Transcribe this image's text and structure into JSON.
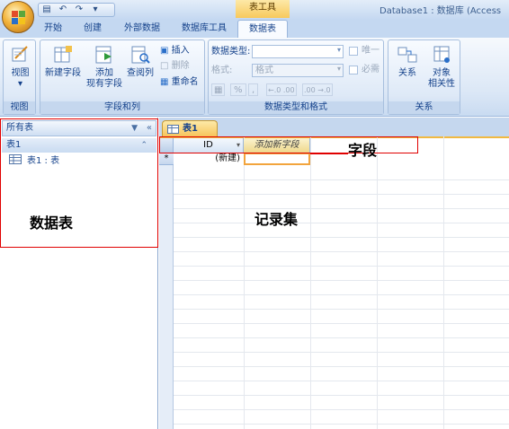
{
  "window": {
    "contextual_tab_group": "表工具",
    "title": "Database1 : 数据库 (Access"
  },
  "tabs": [
    {
      "label": "开始"
    },
    {
      "label": "创建"
    },
    {
      "label": "外部数据"
    },
    {
      "label": "数据库工具"
    },
    {
      "label": "数据表",
      "active": true
    }
  ],
  "ribbon": {
    "view_group": {
      "button": "视图",
      "label": "视图"
    },
    "fields_group": {
      "new_field": "新建字段",
      "add_existing_1": "添加",
      "add_existing_2": "现有字段",
      "lookup_column": "查阅列",
      "insert": "插入",
      "delete": "删除",
      "rename": "重命名",
      "label": "字段和列"
    },
    "datatype_group": {
      "data_type_label": "数据类型:",
      "format_label": "格式:",
      "format_value": "格式",
      "unique": "唯一",
      "required": "必需",
      "percent": "%",
      "inc_decimals": "←.0 .00",
      "dec_decimals": ".00 →.0",
      "label": "数据类型和格式"
    },
    "relations_group": {
      "relationships": "关系",
      "dependencies_1": "对象",
      "dependencies_2": "相关性",
      "label": "关系"
    }
  },
  "nav_pane": {
    "header": "所有表",
    "group": "表1",
    "item": "表1 : 表"
  },
  "document": {
    "tab": "表1",
    "columns": {
      "id": "ID",
      "add_new": "添加新字段"
    },
    "new_row_marker": "*",
    "new_row_value": "(新建)"
  },
  "annotations": {
    "field": "字段",
    "datasheet": "数据表",
    "recordset": "记录集"
  },
  "colors": {
    "annotation_red": "#e00000",
    "ribbon_text": "#15428b",
    "accent_orange": "#f2a43d"
  }
}
